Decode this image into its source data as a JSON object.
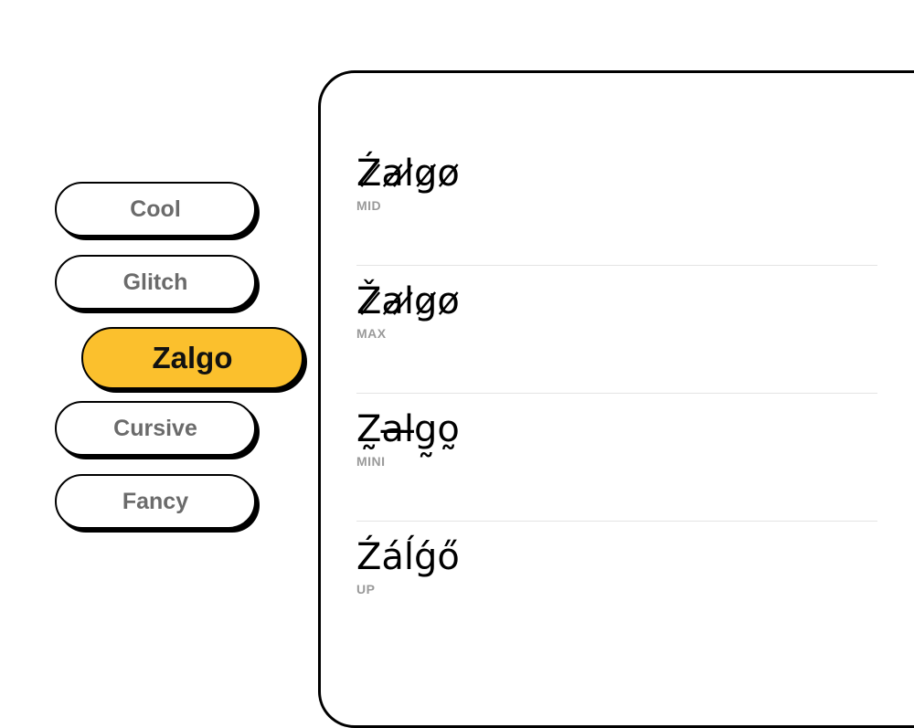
{
  "nav": {
    "items": [
      {
        "label": "Cool"
      },
      {
        "label": "Glitch"
      },
      {
        "label": "Zalgo",
        "active": true
      },
      {
        "label": "Cursive"
      },
      {
        "label": "Fancy"
      }
    ]
  },
  "results": [
    {
      "text": "Ź̷a̷l̷g̷o̷",
      "label": "MID"
    },
    {
      "text": "Ž̷a̷l̷g̷o̷",
      "label": "MAX"
    },
    {
      "text": "Z̰a̶l̶g̰o̰",
      "label": "MINI"
    },
    {
      "text": "Źáĺǵő",
      "label": "UP"
    }
  ],
  "colors": {
    "accent": "#fbc02d",
    "inactive_text": "#6b6b6b",
    "label_text": "#9a9a9a"
  }
}
